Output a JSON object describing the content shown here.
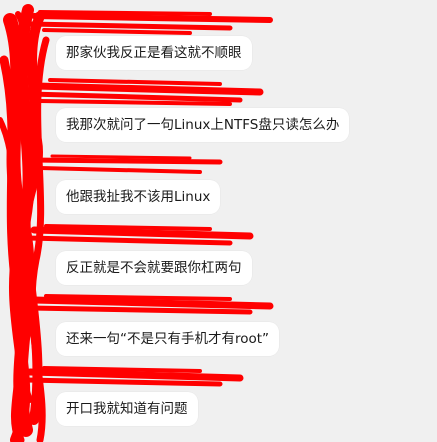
{
  "messages": [
    {
      "text": "那家伙我反正是看这就不顺眼"
    },
    {
      "text": "我那次就问了一句Linux上NTFS盘只读怎么办"
    },
    {
      "text": "他跟我扯我不该用Linux"
    },
    {
      "text": "反正就是不会就要跟你杠两句"
    },
    {
      "text": "还来一句“不是只有手机才有root”"
    },
    {
      "text": "开口我就知道有问题"
    }
  ],
  "colors": {
    "background": "#f0f0f0",
    "bubble": "#ffffff",
    "redaction": "#ff0000",
    "text": "#1a1a1a"
  }
}
